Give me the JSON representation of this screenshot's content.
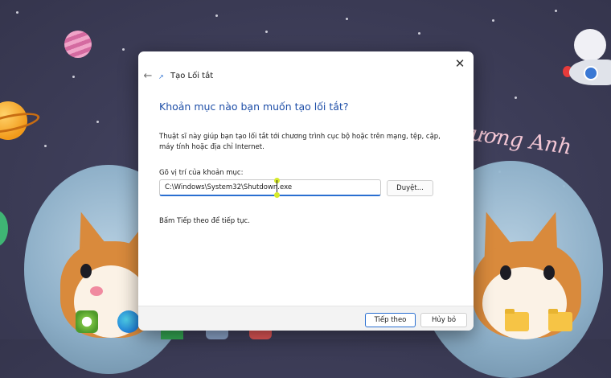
{
  "wallpaper": {
    "script_text": "ương Anh",
    "colors": {
      "background": "#3d3d58",
      "accent_pink": "#f4c7d5"
    }
  },
  "dialog": {
    "title": "Tạo Lối tắt",
    "close_glyph": "✕",
    "back_glyph": "←",
    "heading": "Khoản mục nào bạn muốn tạo lối tắt?",
    "description": "Thuật sĩ này giúp bạn tạo lối tắt tới chương trình cục bộ hoặc trên mạng, tệp, cặp, máy tính hoặc địa chỉ Internet.",
    "field_label": "Gõ vị trí của khoản mục:",
    "path_value": "C:\\Windows\\System32\\Shutdown.exe",
    "browse_label": "Duyệt...",
    "hint": "Bấm Tiếp theo để tiếp tục.",
    "next_label": "Tiếp theo",
    "cancel_label": "Hủy bỏ",
    "colors": {
      "heading": "#1f4fa8",
      "accent": "#2a6fd1"
    }
  },
  "taskbar": {
    "icons": [
      "coccoc-icon",
      "edge-icon",
      "chrome-icon",
      "pdf-icon",
      "folder-icon",
      "folder-icon"
    ]
  }
}
